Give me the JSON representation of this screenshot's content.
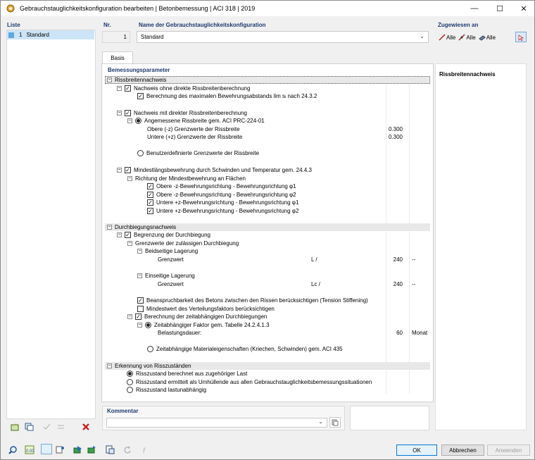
{
  "window": {
    "title": "Gebrauchstauglichkeitskonfiguration bearbeiten | Betonbemessung | ACI 318 | 2019"
  },
  "list": {
    "header": "Liste",
    "items": [
      {
        "num": "1",
        "label": "Standard"
      }
    ]
  },
  "nr": {
    "header": "Nr.",
    "value": "1"
  },
  "name": {
    "header": "Name der Gebrauchstauglichkeitskonfiguration",
    "value": "Standard"
  },
  "assigned": {
    "header": "Zugewiesen an",
    "items": [
      "Alle",
      "Alle",
      "Alle"
    ]
  },
  "tabs": [
    {
      "label": "Basis"
    }
  ],
  "params": {
    "header": "Bemessungsparameter",
    "crack": {
      "title": "Rissbreitennachweis",
      "no_direct": "Nachweis ohne direkte Rissbreitenberechnung",
      "max_spacing": "Berechnung des maximalen Bewehrungsabstands lim sₗ nach 24.3.2",
      "direct": "Nachweis mit direkter Rissbreitenberechnung",
      "adequate": "Angemessene Rissbreite gem. ACI PRC-224-01",
      "upper": "Obere (-z) Grenzwerte der Rissbreite",
      "upper_val": "0.300",
      "lower": "Untere (+z) Grenzwerte der Rissbreite",
      "lower_val": "0.300",
      "user_defined": "Benutzerdefinierte Grenzwerte der Rissbreite",
      "min_long": "Mindestlängsbewehrung durch Schwinden und Temperatur gem. 24.4.3",
      "direction": "Richtung der Mindestbewehrung an Flächen",
      "dirs": [
        "Obere -z-Bewehrungsrichtung - Bewehrungsrichtung φ1",
        "Obere -z-Bewehrungsrichtung - Bewehrungsrichtung φ2",
        "Untere +z-Bewehrungsrichtung - Bewehrungsrichtung φ1",
        "Untere +z-Bewehrungsrichtung - Bewehrungsrichtung φ2"
      ]
    },
    "deflection": {
      "title": "Durchbiegungsnachweis",
      "limit": "Begrenzung der Durchbiegung",
      "allowed": "Grenzwerte der zulässigen Durchbiegung",
      "both": "Beidseitige Lagerung",
      "limit_label": "Grenzwert",
      "both_formula": "L /",
      "both_val": "240",
      "both_unit": "--",
      "one": "Einseitige Lagerung",
      "one_formula": "Lc /",
      "one_val": "240",
      "one_unit": "--",
      "tension": "Beanspruchbarkeit des Betons zwischen den Rissen berücksichtigen (Tension Stiffening)",
      "min_dist": "Mindestwert des Verteilungsfaktors berücksichtigen",
      "time_dep": "Berechnung der zeitabhängigen Durchbiegungen",
      "factor": "Zeitabhängiger Faktor gem. Tabelle 24.2.4.1.3",
      "duration": "Belastungsdauer:",
      "duration_val": "60",
      "duration_unit": "Monat",
      "material": "Zeitabhängige Materialeigenschaften (Kriechen, Schwinden) gem. ACI 435"
    },
    "cracking": {
      "title": "Erkennung von Risszuständen",
      "opt1": "Risszustand berechnet aus zugehöriger Last",
      "opt2": "Risszustand ermittelt als Umhüllende aus allen Gebrauchstauglichkeitsbemessungssituationen",
      "opt3": "Risszustand lastunabhängig"
    }
  },
  "side": {
    "title": "Rissbreitennachweis"
  },
  "comment": {
    "header": "Kommentar",
    "value": ""
  },
  "buttons": {
    "ok": "OK",
    "cancel": "Abbrechen",
    "apply": "Anwenden"
  }
}
